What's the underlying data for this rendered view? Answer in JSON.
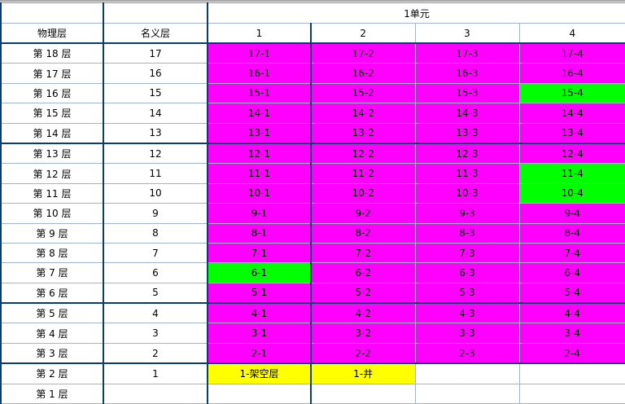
{
  "header": {
    "unit_title": "1单元",
    "physical_floor": "物理层",
    "nominal_floor": "名义层",
    "columns": [
      "1",
      "2",
      "3",
      "4"
    ]
  },
  "colors": {
    "sold": "#ff00ff",
    "highlight": "#00ff00",
    "special": "#ffff00",
    "empty": "#ffffff"
  },
  "rows": [
    {
      "physical": "第 18 层",
      "nominal": "17",
      "cells": [
        {
          "text": "17-1",
          "color": "magenta"
        },
        {
          "text": "17-2",
          "color": "magenta"
        },
        {
          "text": "17-3",
          "color": "magenta"
        },
        {
          "text": "17-4",
          "color": "magenta"
        }
      ]
    },
    {
      "physical": "第 17 层",
      "nominal": "16",
      "cells": [
        {
          "text": "16-1",
          "color": "magenta"
        },
        {
          "text": "16-2",
          "color": "magenta"
        },
        {
          "text": "16-3",
          "color": "magenta"
        },
        {
          "text": "16-4",
          "color": "magenta"
        }
      ]
    },
    {
      "physical": "第 16 层",
      "nominal": "15",
      "cells": [
        {
          "text": "15-1",
          "color": "magenta"
        },
        {
          "text": "15-2",
          "color": "magenta"
        },
        {
          "text": "15-3",
          "color": "magenta"
        },
        {
          "text": "15-4",
          "color": "green"
        }
      ]
    },
    {
      "physical": "第 15 层",
      "nominal": "14",
      "cells": [
        {
          "text": "14-1",
          "color": "magenta"
        },
        {
          "text": "14-2",
          "color": "magenta"
        },
        {
          "text": "14-3",
          "color": "magenta"
        },
        {
          "text": "14-4",
          "color": "magenta"
        }
      ]
    },
    {
      "physical": "第 14 层",
      "nominal": "13",
      "cells": [
        {
          "text": "13-1",
          "color": "magenta"
        },
        {
          "text": "13-2",
          "color": "magenta"
        },
        {
          "text": "13-3",
          "color": "magenta"
        },
        {
          "text": "13-4",
          "color": "magenta"
        }
      ]
    },
    {
      "physical": "第 13 层",
      "nominal": "12",
      "cells": [
        {
          "text": "12-1",
          "color": "magenta"
        },
        {
          "text": "12-2",
          "color": "magenta"
        },
        {
          "text": "12-3",
          "color": "magenta"
        },
        {
          "text": "12-4",
          "color": "magenta"
        }
      ]
    },
    {
      "physical": "第 12 层",
      "nominal": "11",
      "cells": [
        {
          "text": "11-1",
          "color": "magenta"
        },
        {
          "text": "11-2",
          "color": "magenta"
        },
        {
          "text": "11-3",
          "color": "magenta"
        },
        {
          "text": "11-4",
          "color": "green"
        }
      ]
    },
    {
      "physical": "第 11 层",
      "nominal": "10",
      "cells": [
        {
          "text": "10-1",
          "color": "magenta"
        },
        {
          "text": "10-2",
          "color": "magenta"
        },
        {
          "text": "10-3",
          "color": "magenta"
        },
        {
          "text": "10-4",
          "color": "green"
        }
      ]
    },
    {
      "physical": "第 10 层",
      "nominal": "9",
      "cells": [
        {
          "text": "9-1",
          "color": "magenta"
        },
        {
          "text": "9-2",
          "color": "magenta"
        },
        {
          "text": "9-3",
          "color": "magenta"
        },
        {
          "text": "9-4",
          "color": "magenta"
        }
      ]
    },
    {
      "physical": "第 9 层",
      "nominal": "8",
      "cells": [
        {
          "text": "8-1",
          "color": "magenta"
        },
        {
          "text": "8-2",
          "color": "magenta"
        },
        {
          "text": "8-3",
          "color": "magenta"
        },
        {
          "text": "8-4",
          "color": "magenta"
        }
      ]
    },
    {
      "physical": "第 8 层",
      "nominal": "7",
      "cells": [
        {
          "text": "7-1",
          "color": "magenta"
        },
        {
          "text": "7-2",
          "color": "magenta"
        },
        {
          "text": "7-3",
          "color": "magenta"
        },
        {
          "text": "7-4",
          "color": "magenta"
        }
      ]
    },
    {
      "physical": "第 7 层",
      "nominal": "6",
      "cells": [
        {
          "text": "6-1",
          "color": "green"
        },
        {
          "text": "6-2",
          "color": "magenta"
        },
        {
          "text": "6-3",
          "color": "magenta"
        },
        {
          "text": "6-4",
          "color": "magenta"
        }
      ]
    },
    {
      "physical": "第 6 层",
      "nominal": "5",
      "cells": [
        {
          "text": "5-1",
          "color": "magenta"
        },
        {
          "text": "5-2",
          "color": "magenta"
        },
        {
          "text": "5-3",
          "color": "magenta"
        },
        {
          "text": "5-4",
          "color": "magenta"
        }
      ]
    },
    {
      "physical": "第 5 层",
      "nominal": "4",
      "cells": [
        {
          "text": "4-1",
          "color": "magenta"
        },
        {
          "text": "4-2",
          "color": "magenta"
        },
        {
          "text": "4-3",
          "color": "magenta"
        },
        {
          "text": "4-4",
          "color": "magenta"
        }
      ]
    },
    {
      "physical": "第 4 层",
      "nominal": "3",
      "cells": [
        {
          "text": "3-1",
          "color": "magenta"
        },
        {
          "text": "3-2",
          "color": "magenta"
        },
        {
          "text": "3-3",
          "color": "magenta"
        },
        {
          "text": "3-4",
          "color": "magenta"
        }
      ]
    },
    {
      "physical": "第 3 层",
      "nominal": "2",
      "cells": [
        {
          "text": "2-1",
          "color": "magenta"
        },
        {
          "text": "2-2",
          "color": "magenta"
        },
        {
          "text": "2-3",
          "color": "magenta"
        },
        {
          "text": "2-4",
          "color": "magenta"
        }
      ]
    },
    {
      "physical": "第 2 层",
      "nominal": "1",
      "cells": [
        {
          "text": "1-架空层",
          "color": "yellow"
        },
        {
          "text": "1-井",
          "color": "yellow"
        },
        {
          "text": "",
          "color": "white"
        },
        {
          "text": "",
          "color": "white"
        }
      ]
    },
    {
      "physical": "第 1 层",
      "nominal": "",
      "cells": [
        {
          "text": "",
          "color": "white"
        },
        {
          "text": "",
          "color": "white"
        },
        {
          "text": "",
          "color": "white"
        },
        {
          "text": "",
          "color": "white"
        }
      ]
    }
  ]
}
